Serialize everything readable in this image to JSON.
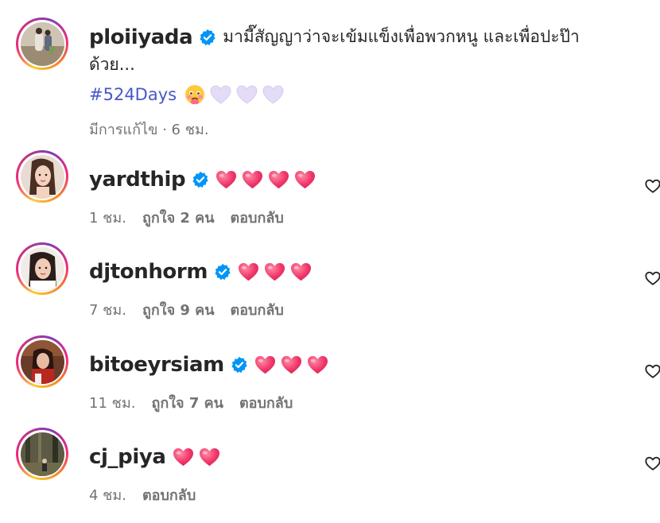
{
  "caption": {
    "username": "ploiiyada",
    "text_line1": "มามี๊สัญญาว่าจะเข้มแข็งเพื่อพวกหนู และเพื่อปะป๊า",
    "text_line2": "ด้วย...",
    "hashtag": "#524Days",
    "edited_label": "มีการแก้ไข · 6 ชม."
  },
  "comments": [
    {
      "username": "yardthip",
      "time": "1 ชม.",
      "likes": "ถูกใจ 2 คน",
      "reply": "ตอบกลับ",
      "heart_count": 4
    },
    {
      "username": "djtonhorm",
      "time": "7 ชม.",
      "likes": "ถูกใจ 9 คน",
      "reply": "ตอบกลับ",
      "heart_count": 3
    },
    {
      "username": "bitoeyrsiam",
      "time": "11 ชม.",
      "likes": "ถูกใจ 7 คน",
      "reply": "ตอบกลับ",
      "heart_count": 3
    },
    {
      "username": "cj_piya",
      "time": "4 ชม.",
      "likes": "",
      "reply": "ตอบกลับ",
      "heart_count": 2
    }
  ],
  "colors": {
    "verified_blue": "#0095f6",
    "hashtag_blue": "#4957c9",
    "heart_red": "#f0386b",
    "white_heart": "#e4dcf6",
    "meta_gray": "#737373"
  },
  "icons": {
    "verified": "verified-badge-icon",
    "heart": "red-heart-emoji-icon",
    "white_heart": "white-heart-emoji-icon",
    "face": "face-holding-back-tears-emoji-icon",
    "like": "heart-outline-icon"
  }
}
